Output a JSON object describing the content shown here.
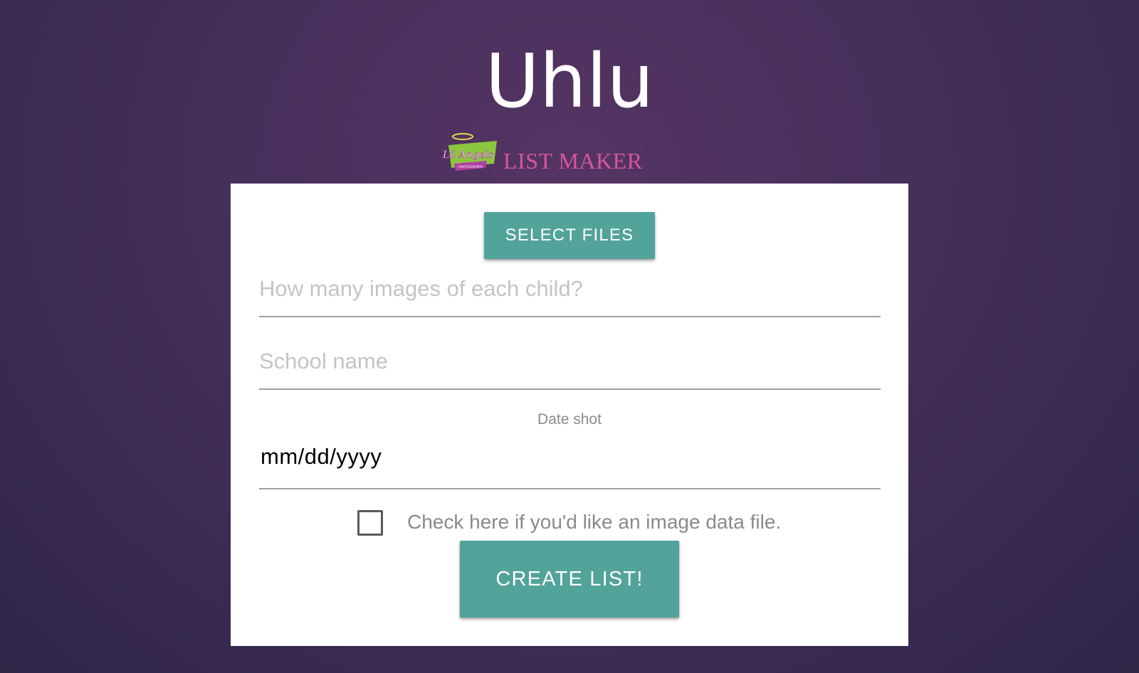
{
  "header": {
    "title": "Uhlu",
    "subtitle": "LIST MAKER",
    "logo_text": "Lil Angels",
    "logo_small_text": "PHOTOGRAPHY"
  },
  "form": {
    "select_files_label": "SELECT FILES",
    "images_per_child_placeholder": "How many images of each child?",
    "school_name_placeholder": "School name",
    "date_label": "Date shot",
    "date_value": "mm/dd/yyyy",
    "checkbox_label": "Check here if you'd like an image data file.",
    "checkbox_checked": false,
    "create_list_label": "CREATE LIST!"
  },
  "colors": {
    "accent": "#52a39a",
    "subtitle": "#d6569a",
    "background": "#46305a"
  }
}
